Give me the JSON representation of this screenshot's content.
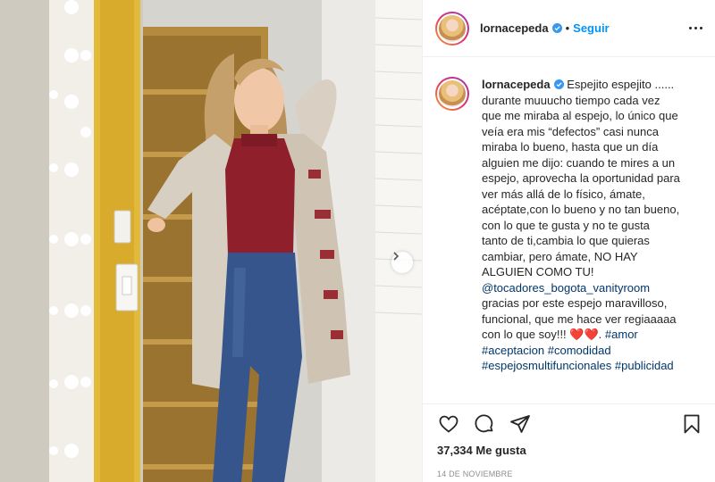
{
  "header": {
    "username": "lornacepeda",
    "separator": "•",
    "follow_label": "Seguir"
  },
  "caption": {
    "username": "lornacepeda",
    "lines": [
      "Espejito espejito ......",
      "durante muuucho tiempo cada vez",
      "que me miraba al espejo, lo único que",
      "veía era mis “defectos” casi nunca",
      "miraba lo bueno, hasta que un día",
      "alguien me dijo: cuando te mires a un",
      "espejo, aprovecha la oportunidad para",
      "ver más allá de lo físico, ámate,",
      "acéptate,con lo bueno y no tan bueno,",
      "con lo que te gusta y no te gusta",
      "tanto de ti,cambia lo que quieras",
      "cambiar, pero ámate, NO HAY",
      "ALGUIEN COMO TU!"
    ],
    "mention": "@tocadores_bogota_vanityroom",
    "lines_after": [
      "gracias por este espejo maravilloso,",
      "funcional, que me hace ver regiaaaaa",
      "con lo que soy!!!"
    ],
    "hearts": "❤️❤️",
    "hashtags": {
      "amor": "#amor",
      "aceptacion": "#aceptacion",
      "comodidad": "#comodidad",
      "espejos": "#espejosmultifuncionales",
      "publicidad": "#publicidad"
    }
  },
  "stats": {
    "likes": "37,334 Me gusta",
    "date": "14 DE NOVIEMBRE"
  },
  "colors": {
    "follow": "#0095f6",
    "link": "#00376b",
    "heart": "#e0243a",
    "verified": "#3897f0",
    "muted": "#8e8e8e"
  },
  "icons": {
    "verified": "verified-badge-icon",
    "more": "more-options-icon",
    "like": "heart-icon",
    "comment": "comment-icon",
    "share": "paper-plane-icon",
    "save": "bookmark-icon",
    "carousel_next": "chevron-right-icon"
  }
}
